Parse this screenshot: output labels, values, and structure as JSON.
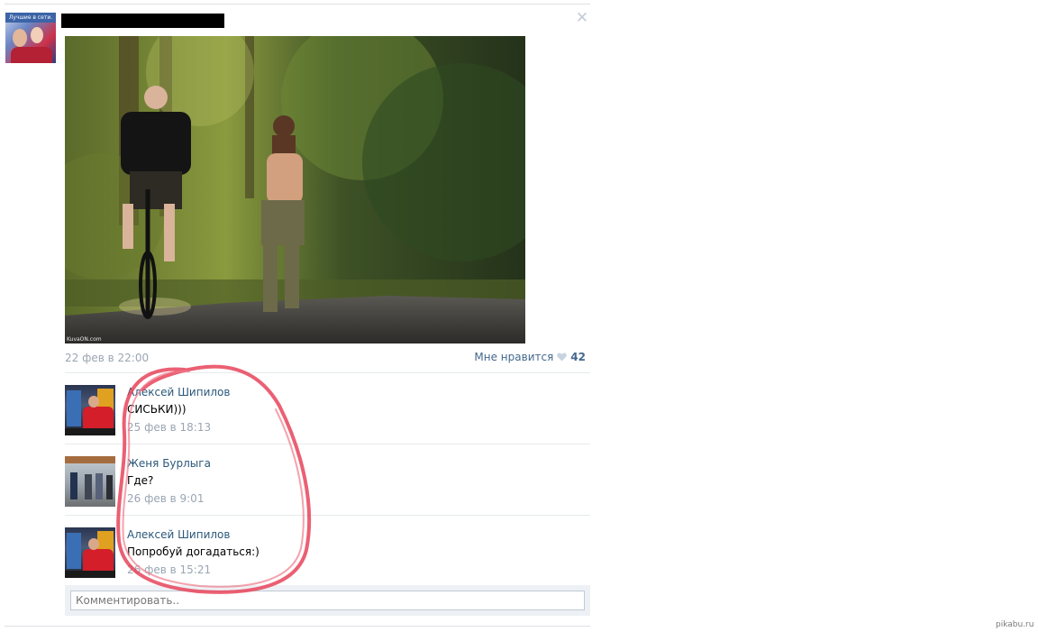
{
  "group": {
    "avatar_label": "Лучшие в сети.",
    "avatar_icon": "group-avatar-image"
  },
  "post": {
    "photo_watermark": "KuvaON.com",
    "date": "22 фев в 22:00",
    "like_label": "Мне нравится",
    "like_icon": "heart-icon",
    "like_count": "42",
    "close_icon": "✕"
  },
  "comments": [
    {
      "author": "Алексей Шипилов",
      "text": "СИСЬКИ)))",
      "date": "25 фев в 18:13",
      "avatar": "arcade-photo"
    },
    {
      "author": "Женя Бурлыга",
      "text": "Где?",
      "date": "26 фев в 9:01",
      "avatar": "street-photo"
    },
    {
      "author": "Алексей Шипилов",
      "text": "Попробуй догадаться:)",
      "date": "26 фев в 15:21",
      "avatar": "arcade-photo"
    }
  ],
  "comment_input": {
    "placeholder": "Комментировать.."
  },
  "watermark": "pikabu.ru",
  "colors": {
    "link": "#2b587a",
    "like_link": "#45688e",
    "date_gray": "#9aa5b3",
    "highlight_red": "#e8445a",
    "comment_box_bg": "#edf1f5"
  }
}
